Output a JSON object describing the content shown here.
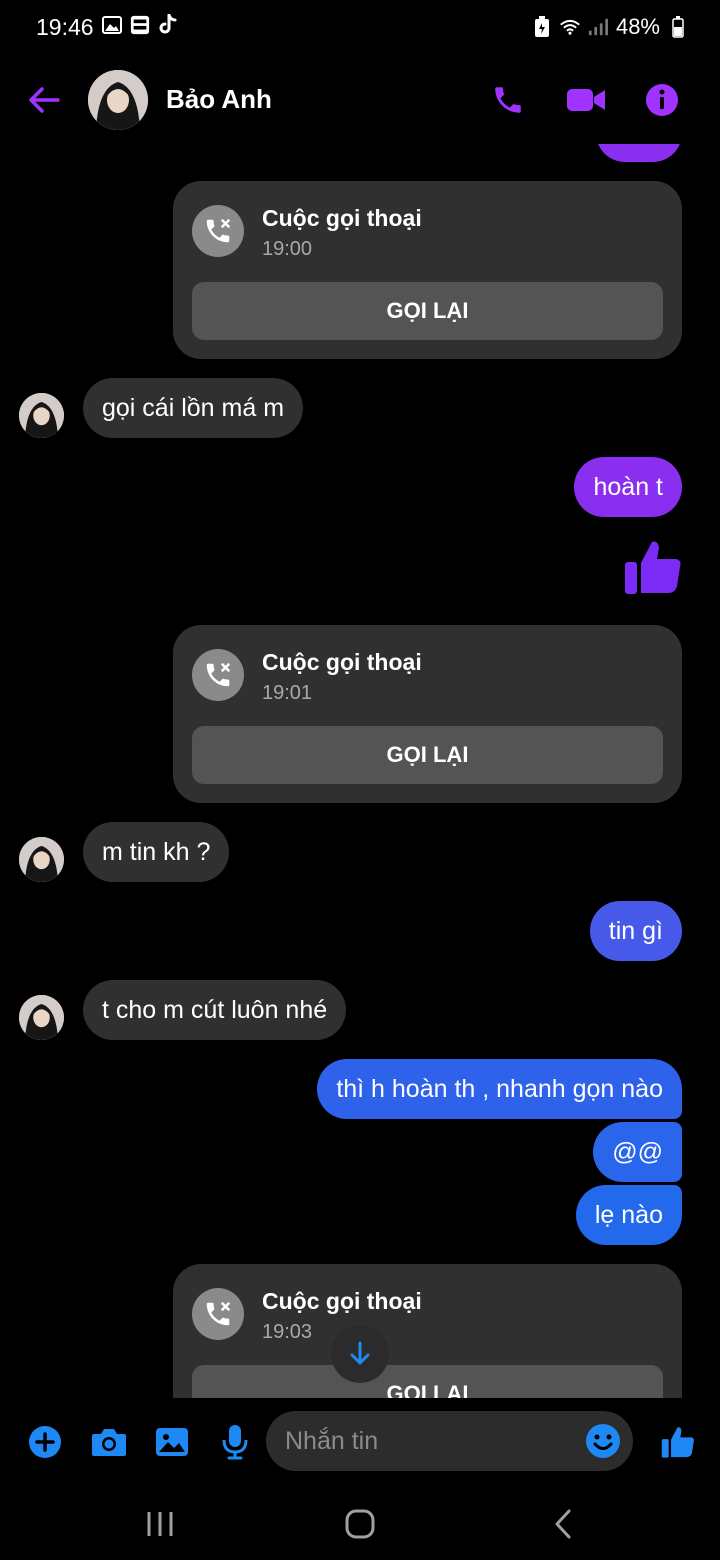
{
  "status_bar": {
    "time": "19:46",
    "battery": "48%",
    "left_icons": [
      "gallery-icon",
      "baomoi-icon",
      "tiktok-icon"
    ],
    "right_icons": [
      "battery-saver-icon",
      "wifi-icon",
      "signal-icon",
      "battery-icon"
    ]
  },
  "header": {
    "contact_name": "Bảo Anh",
    "accent_color": "#a033ff"
  },
  "messages": {
    "call_cards": [
      {
        "title": "Cuộc gọi thoại",
        "time": "19:00",
        "button": "GỌI LẠI"
      },
      {
        "title": "Cuộc gọi thoại",
        "time": "19:01",
        "button": "GỌI LẠI"
      },
      {
        "title": "Cuộc gọi thoại",
        "time": "19:03",
        "button": "GỌI LẠI"
      }
    ],
    "incoming": [
      {
        "text": "gọi cái lồn má m"
      },
      {
        "text": "m tin kh ?"
      },
      {
        "text": "t cho m cút luôn nhé"
      }
    ],
    "outgoing": [
      {
        "text": "hoàn t",
        "color": "#8a2ff0"
      },
      {
        "text": "tin gì",
        "color": "#4659e8"
      },
      {
        "text": "thì h hoàn th , nhanh gọn nào",
        "color": "#2f62ea"
      },
      {
        "text": "@@",
        "color": "#2a66eb"
      },
      {
        "text": "lẹ nào",
        "color": "#2269ec"
      }
    ]
  },
  "composer": {
    "placeholder": "Nhắn tin",
    "icon_color": "#1e88f5"
  }
}
